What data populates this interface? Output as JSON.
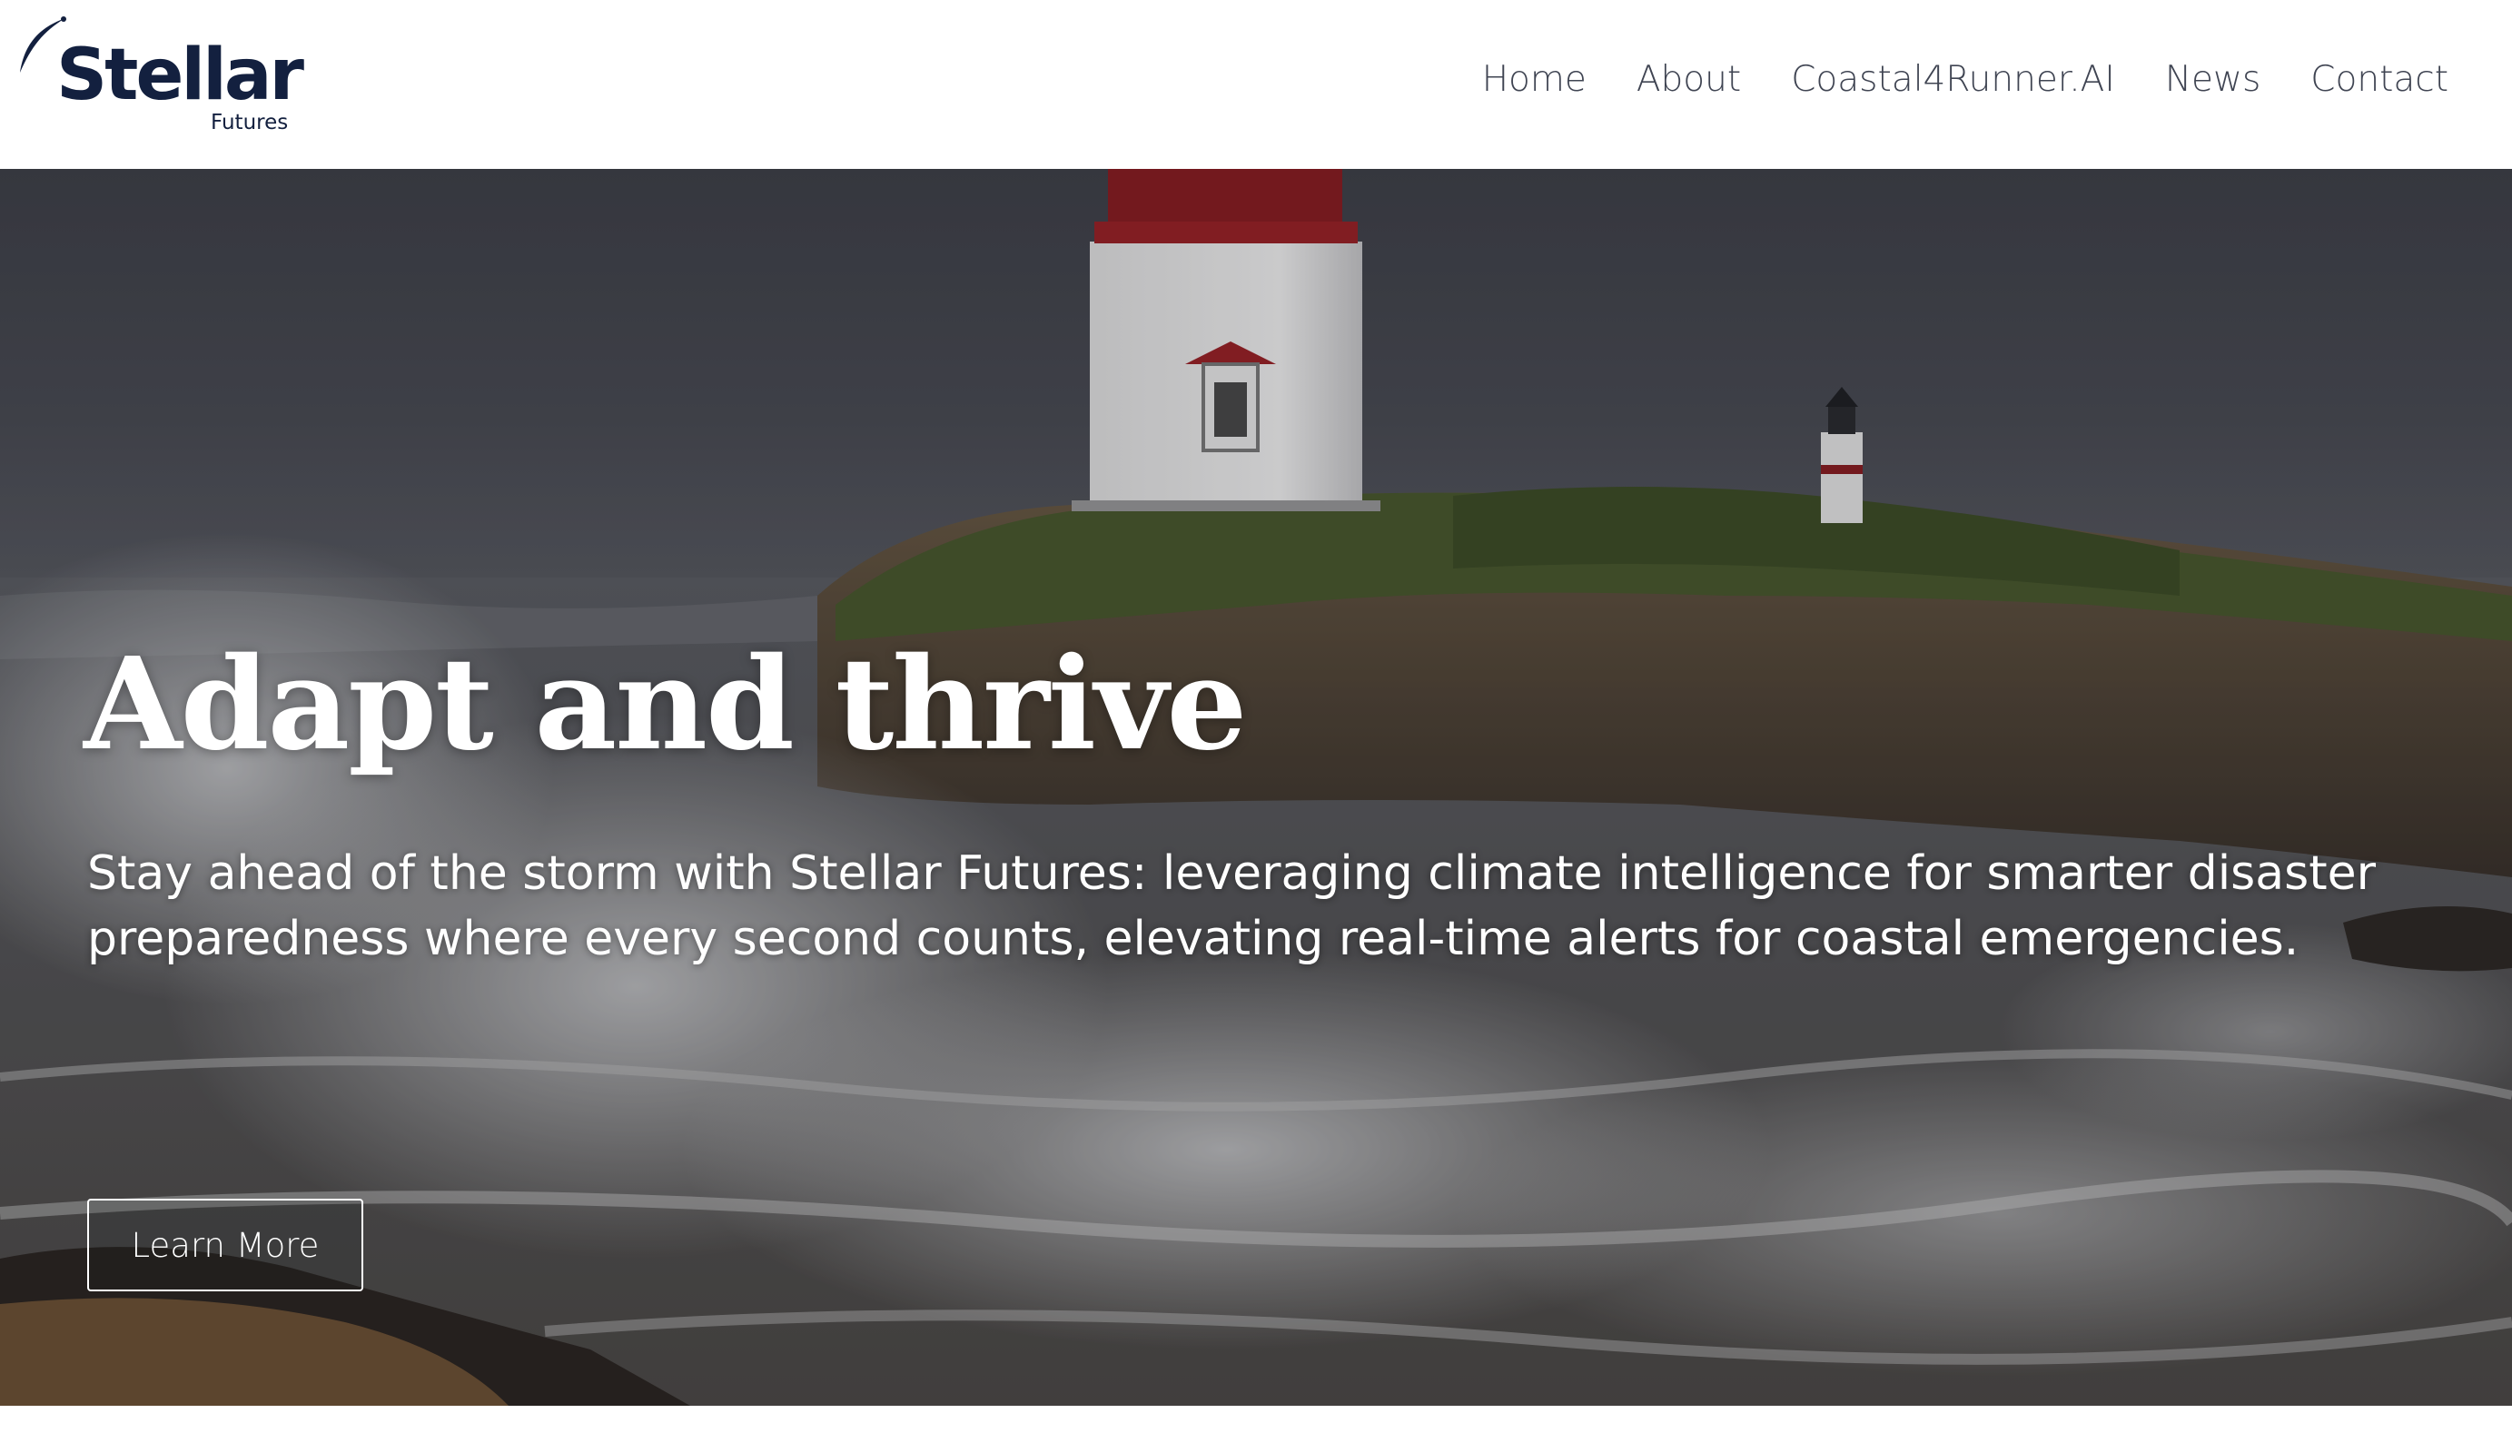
{
  "brand": {
    "name": "Stellar",
    "sub": "Futures",
    "color": "#13203f"
  },
  "nav": {
    "items": [
      {
        "label": "Home"
      },
      {
        "label": "About"
      },
      {
        "label": "Coastal4Runner.AI"
      },
      {
        "label": "News"
      },
      {
        "label": "Contact"
      }
    ]
  },
  "hero": {
    "title": "Adapt and thrive",
    "subtitle": "Stay ahead of the storm with Stellar Futures: leveraging climate intelligence for smarter disaster preparedness where every second counts, elevating real-time alerts for coastal emergencies.",
    "button_label": "Learn More",
    "image_subject": "lighthouse on rocky coast with storm waves"
  },
  "icons": {
    "logo_mark": "swoosh-star-icon"
  }
}
